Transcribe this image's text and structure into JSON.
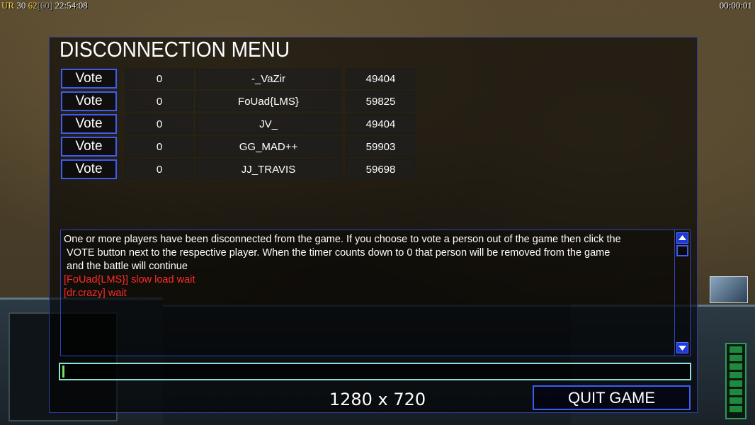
{
  "hud": {
    "stats_prefix": "UR",
    "stat_a": "30",
    "stat_b": "62",
    "stat_c": "[60]",
    "clock": "22:54:08",
    "game_timer": "00:00:01"
  },
  "menu": {
    "title": "DISCONNECTION MENU",
    "players": [
      {
        "vote_label": "Vote",
        "count": "0",
        "name": "-_VaZir",
        "ping": "49404"
      },
      {
        "vote_label": "Vote",
        "count": "0",
        "name": "FoUad{LMS}",
        "ping": "59825"
      },
      {
        "vote_label": "Vote",
        "count": "0",
        "name": "JV_",
        "ping": "49404"
      },
      {
        "vote_label": "Vote",
        "count": "0",
        "name": "GG_MAD++",
        "ping": "59903"
      },
      {
        "vote_label": "Vote",
        "count": "0",
        "name": "JJ_TRAVIS",
        "ping": "59698"
      }
    ],
    "chat": {
      "system_line_1": "One or more players have been disconnected from the game. If you choose to vote a person out of the game then click the",
      "system_line_2": " VOTE button next to the respective player. When the timer counts down to 0 that person will be removed from the game",
      "system_line_3": " and the battle will continue",
      "messages": [
        "[FoUad{LMS}] slow load wait",
        "[dr.crazy] wait"
      ]
    },
    "chat_input_value": "",
    "quit_label": "QUIT GAME"
  },
  "overlay": {
    "resolution": "1280 x 720"
  },
  "colors": {
    "panel_border": "#2e3ca0",
    "button_border": "#3c5cf2",
    "chat_red": "#ff2a2a",
    "input_border": "#89e1d8"
  }
}
